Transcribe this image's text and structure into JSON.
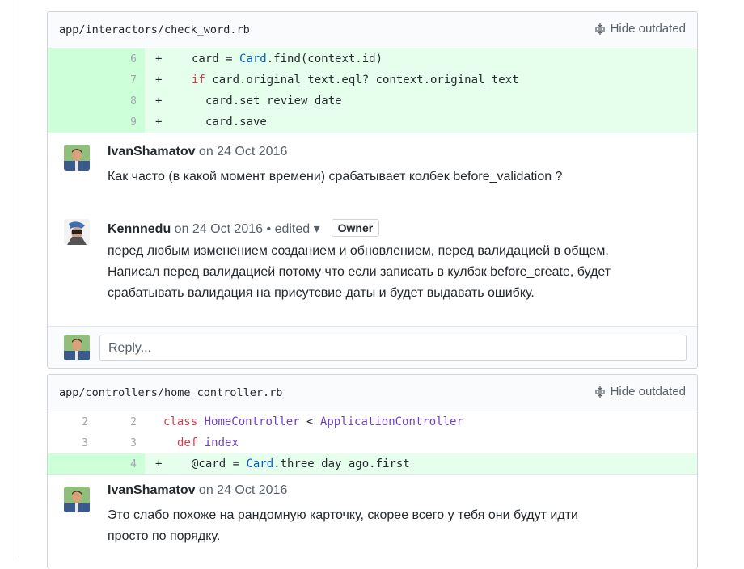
{
  "threads": [
    {
      "file_path": "app/interactors/check_word.rb",
      "hide_outdated_label": "Hide outdated",
      "lines": [
        {
          "old": "",
          "new": "6",
          "sign": "+",
          "code": "card = Card.find(context.id)"
        },
        {
          "old": "",
          "new": "7",
          "sign": "+",
          "code": "if card.original_text.eql? context.original_text"
        },
        {
          "old": "",
          "new": "8",
          "sign": "+",
          "code": "card.set_review_date"
        },
        {
          "old": "",
          "new": "9",
          "sign": "+",
          "code": "card.save"
        }
      ],
      "comments": [
        {
          "author": "IvanShamatov",
          "meta": " on 24 Oct 2016",
          "body": [
            "Как часто (в какой момент времени) срабатывает колбек before_validation ?"
          ]
        },
        {
          "author": "Kennnedu",
          "meta": " on 24 Oct 2016 • edited ▾",
          "badge": "Owner",
          "body": [
            "перед любым изменением созданием и обновлением, перед валидацией в общем.",
            "Написал перед валидацией потому что если записать в кулбэк before_create, будет",
            "срабатывать валидация на присутсвие даты и будет выдавать ошибку."
          ]
        }
      ],
      "reply_placeholder": "Reply..."
    },
    {
      "file_path": "app/controllers/home_controller.rb",
      "hide_outdated_label": "Hide outdated",
      "lines": [
        {
          "old": "2",
          "new": "2",
          "sign": "",
          "code": "class HomeController < ApplicationController"
        },
        {
          "old": "3",
          "new": "3",
          "sign": "",
          "code": "def index"
        },
        {
          "old": "",
          "new": "4",
          "sign": "+",
          "code": "@card = Card.three_day_ago.first"
        }
      ],
      "comments": [
        {
          "author": "IvanShamatov",
          "meta": " on 24 Oct 2016",
          "body": [
            "Это слабо похоже на рандомную карточку, скорее всего у тебя они будут идти",
            "просто по порядку."
          ]
        }
      ]
    }
  ],
  "colors": {
    "addition_bg": "#e6ffed",
    "addition_gutter": "#cdffd8",
    "keyword": "#d73a49",
    "constant": "#005cc5",
    "class_name": "#6f42c1"
  }
}
